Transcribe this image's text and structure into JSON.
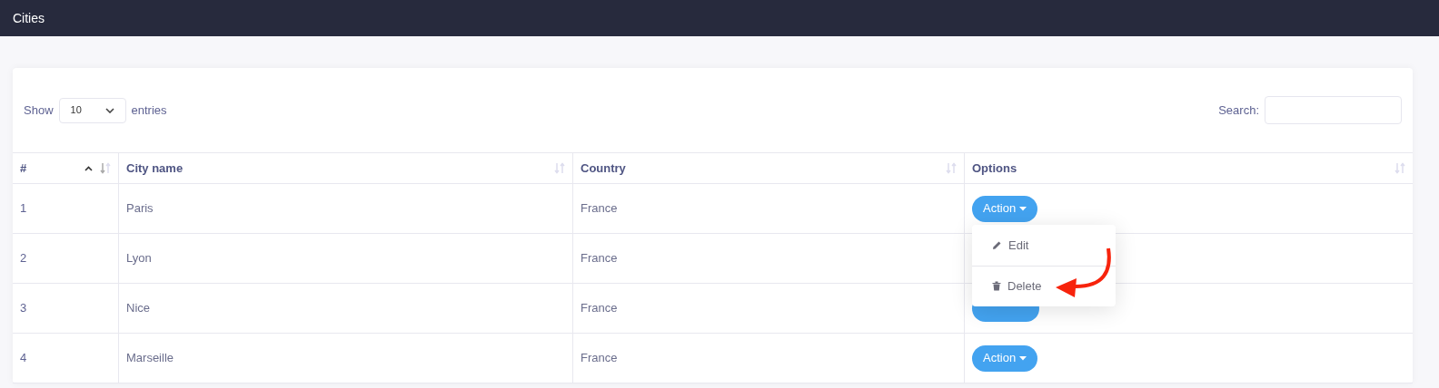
{
  "header": {
    "title": "Cities"
  },
  "length_control": {
    "before": "Show",
    "value": "10",
    "after": "entries"
  },
  "search": {
    "label": "Search:"
  },
  "table": {
    "columns": [
      {
        "label": "#",
        "sorted": true
      },
      {
        "label": "City name",
        "sorted": false
      },
      {
        "label": "Country",
        "sorted": false
      },
      {
        "label": "Options",
        "sorted": false
      }
    ],
    "rows": [
      {
        "cells": [
          "1",
          "Paris",
          "France"
        ],
        "action": {
          "label": "Action",
          "menu": [
            {
              "kind": "edit",
              "label": "Edit"
            },
            {
              "kind": "delete",
              "label": "Delete"
            }
          ]
        }
      },
      {
        "cells": [
          "2",
          "Lyon",
          "France"
        ]
      },
      {
        "cells": [
          "3",
          "Nice",
          "France"
        ],
        "action": {}
      },
      {
        "cells": [
          "4",
          "Marseille",
          "France"
        ],
        "action": {
          "label": "Action"
        }
      }
    ]
  }
}
